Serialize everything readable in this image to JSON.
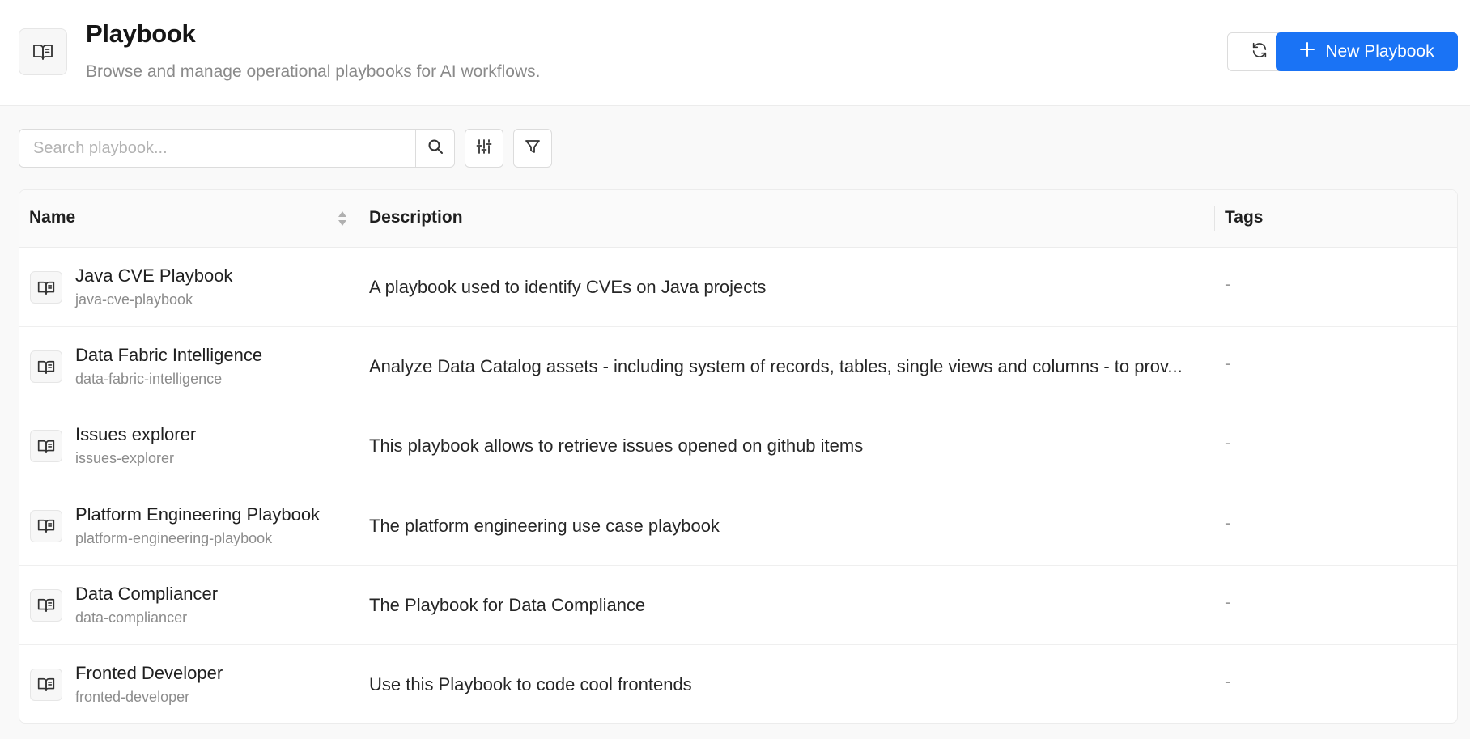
{
  "header": {
    "title": "Playbook",
    "subtitle": "Browse and manage operational playbooks for AI workflows.",
    "new_button_label": "New Playbook",
    "icon": "book-open-icon"
  },
  "toolbar": {
    "search_placeholder": "Search playbook...",
    "search_value": ""
  },
  "table": {
    "columns": [
      "Name",
      "Description",
      "Tags"
    ],
    "rows": [
      {
        "name": "Java CVE Playbook",
        "slug": "java-cve-playbook",
        "description": "A playbook used to identify CVEs on Java projects",
        "tags": "-"
      },
      {
        "name": "Data Fabric Intelligence",
        "slug": "data-fabric-intelligence",
        "description": "Analyze Data Catalog assets - including system of records, tables, single views and columns - to prov...",
        "tags": "-"
      },
      {
        "name": "Issues explorer",
        "slug": "issues-explorer",
        "description": "This playbook allows to retrieve issues opened on github items",
        "tags": "-"
      },
      {
        "name": "Platform Engineering Playbook",
        "slug": "platform-engineering-playbook",
        "description": "The platform engineering use case playbook",
        "tags": "-"
      },
      {
        "name": "Data Compliancer",
        "slug": "data-compliancer",
        "description": "The Playbook for Data Compliance",
        "tags": "-"
      },
      {
        "name": "Fronted Developer",
        "slug": "fronted-developer",
        "description": "Use this Playbook to code cool frontends",
        "tags": "-"
      }
    ]
  },
  "colors": {
    "primary": "#1a73f5",
    "background": "#f9f9f9"
  }
}
